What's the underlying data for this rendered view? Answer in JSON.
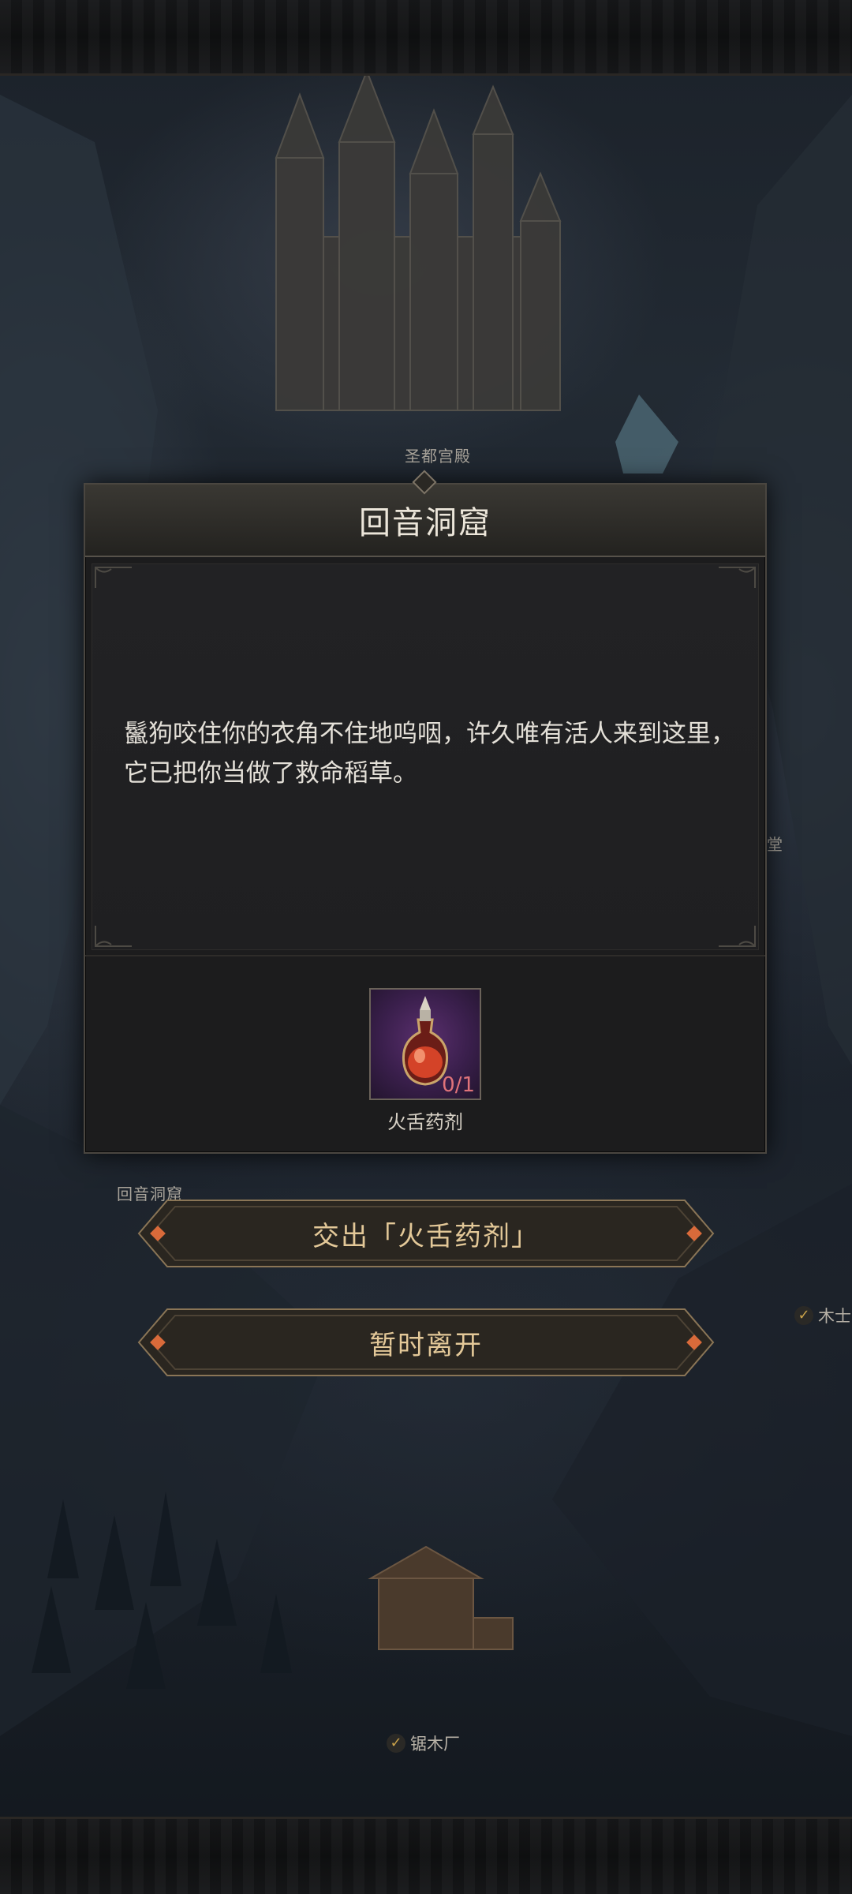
{
  "map": {
    "location_labels": {
      "palace": "圣都宫殿",
      "cave": "回音洞窟",
      "hall_partial": "堂"
    },
    "checkpoints": [
      {
        "label": "木士",
        "checked": true
      },
      {
        "label": "锯木厂",
        "checked": true
      }
    ]
  },
  "dialog": {
    "title": "回音洞窟",
    "story": "鬣狗咬住你的衣角不住地呜咽，许久唯有活人来到这里，它已把你当做了救命稻草。",
    "required_item": {
      "name": "火舌药剂",
      "count": "0/1",
      "icon": "potion-icon"
    }
  },
  "actions": {
    "hand_over": "交出「火舌药剂」",
    "leave": "暂时离开"
  },
  "colors": {
    "accent_gold": "#e3c898",
    "count_red": "#e0737a",
    "panel_bg": "#1c1c1d",
    "rarity_purple": "#5a2f6e"
  }
}
